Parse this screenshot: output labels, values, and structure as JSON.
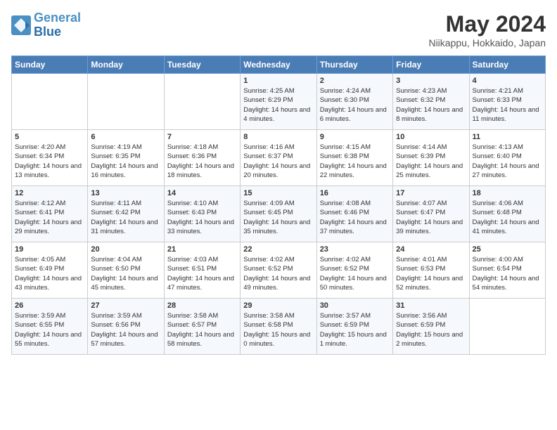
{
  "header": {
    "logo_line1": "General",
    "logo_line2": "Blue",
    "month": "May 2024",
    "location": "Niikappu, Hokkaido, Japan"
  },
  "days_of_week": [
    "Sunday",
    "Monday",
    "Tuesday",
    "Wednesday",
    "Thursday",
    "Friday",
    "Saturday"
  ],
  "weeks": [
    [
      {
        "day": "",
        "sunrise": "",
        "sunset": "",
        "daylight": ""
      },
      {
        "day": "",
        "sunrise": "",
        "sunset": "",
        "daylight": ""
      },
      {
        "day": "",
        "sunrise": "",
        "sunset": "",
        "daylight": ""
      },
      {
        "day": "1",
        "sunrise": "Sunrise: 4:25 AM",
        "sunset": "Sunset: 6:29 PM",
        "daylight": "Daylight: 14 hours and 4 minutes."
      },
      {
        "day": "2",
        "sunrise": "Sunrise: 4:24 AM",
        "sunset": "Sunset: 6:30 PM",
        "daylight": "Daylight: 14 hours and 6 minutes."
      },
      {
        "day": "3",
        "sunrise": "Sunrise: 4:23 AM",
        "sunset": "Sunset: 6:32 PM",
        "daylight": "Daylight: 14 hours and 8 minutes."
      },
      {
        "day": "4",
        "sunrise": "Sunrise: 4:21 AM",
        "sunset": "Sunset: 6:33 PM",
        "daylight": "Daylight: 14 hours and 11 minutes."
      }
    ],
    [
      {
        "day": "5",
        "sunrise": "Sunrise: 4:20 AM",
        "sunset": "Sunset: 6:34 PM",
        "daylight": "Daylight: 14 hours and 13 minutes."
      },
      {
        "day": "6",
        "sunrise": "Sunrise: 4:19 AM",
        "sunset": "Sunset: 6:35 PM",
        "daylight": "Daylight: 14 hours and 16 minutes."
      },
      {
        "day": "7",
        "sunrise": "Sunrise: 4:18 AM",
        "sunset": "Sunset: 6:36 PM",
        "daylight": "Daylight: 14 hours and 18 minutes."
      },
      {
        "day": "8",
        "sunrise": "Sunrise: 4:16 AM",
        "sunset": "Sunset: 6:37 PM",
        "daylight": "Daylight: 14 hours and 20 minutes."
      },
      {
        "day": "9",
        "sunrise": "Sunrise: 4:15 AM",
        "sunset": "Sunset: 6:38 PM",
        "daylight": "Daylight: 14 hours and 22 minutes."
      },
      {
        "day": "10",
        "sunrise": "Sunrise: 4:14 AM",
        "sunset": "Sunset: 6:39 PM",
        "daylight": "Daylight: 14 hours and 25 minutes."
      },
      {
        "day": "11",
        "sunrise": "Sunrise: 4:13 AM",
        "sunset": "Sunset: 6:40 PM",
        "daylight": "Daylight: 14 hours and 27 minutes."
      }
    ],
    [
      {
        "day": "12",
        "sunrise": "Sunrise: 4:12 AM",
        "sunset": "Sunset: 6:41 PM",
        "daylight": "Daylight: 14 hours and 29 minutes."
      },
      {
        "day": "13",
        "sunrise": "Sunrise: 4:11 AM",
        "sunset": "Sunset: 6:42 PM",
        "daylight": "Daylight: 14 hours and 31 minutes."
      },
      {
        "day": "14",
        "sunrise": "Sunrise: 4:10 AM",
        "sunset": "Sunset: 6:43 PM",
        "daylight": "Daylight: 14 hours and 33 minutes."
      },
      {
        "day": "15",
        "sunrise": "Sunrise: 4:09 AM",
        "sunset": "Sunset: 6:45 PM",
        "daylight": "Daylight: 14 hours and 35 minutes."
      },
      {
        "day": "16",
        "sunrise": "Sunrise: 4:08 AM",
        "sunset": "Sunset: 6:46 PM",
        "daylight": "Daylight: 14 hours and 37 minutes."
      },
      {
        "day": "17",
        "sunrise": "Sunrise: 4:07 AM",
        "sunset": "Sunset: 6:47 PM",
        "daylight": "Daylight: 14 hours and 39 minutes."
      },
      {
        "day": "18",
        "sunrise": "Sunrise: 4:06 AM",
        "sunset": "Sunset: 6:48 PM",
        "daylight": "Daylight: 14 hours and 41 minutes."
      }
    ],
    [
      {
        "day": "19",
        "sunrise": "Sunrise: 4:05 AM",
        "sunset": "Sunset: 6:49 PM",
        "daylight": "Daylight: 14 hours and 43 minutes."
      },
      {
        "day": "20",
        "sunrise": "Sunrise: 4:04 AM",
        "sunset": "Sunset: 6:50 PM",
        "daylight": "Daylight: 14 hours and 45 minutes."
      },
      {
        "day": "21",
        "sunrise": "Sunrise: 4:03 AM",
        "sunset": "Sunset: 6:51 PM",
        "daylight": "Daylight: 14 hours and 47 minutes."
      },
      {
        "day": "22",
        "sunrise": "Sunrise: 4:02 AM",
        "sunset": "Sunset: 6:52 PM",
        "daylight": "Daylight: 14 hours and 49 minutes."
      },
      {
        "day": "23",
        "sunrise": "Sunrise: 4:02 AM",
        "sunset": "Sunset: 6:52 PM",
        "daylight": "Daylight: 14 hours and 50 minutes."
      },
      {
        "day": "24",
        "sunrise": "Sunrise: 4:01 AM",
        "sunset": "Sunset: 6:53 PM",
        "daylight": "Daylight: 14 hours and 52 minutes."
      },
      {
        "day": "25",
        "sunrise": "Sunrise: 4:00 AM",
        "sunset": "Sunset: 6:54 PM",
        "daylight": "Daylight: 14 hours and 54 minutes."
      }
    ],
    [
      {
        "day": "26",
        "sunrise": "Sunrise: 3:59 AM",
        "sunset": "Sunset: 6:55 PM",
        "daylight": "Daylight: 14 hours and 55 minutes."
      },
      {
        "day": "27",
        "sunrise": "Sunrise: 3:59 AM",
        "sunset": "Sunset: 6:56 PM",
        "daylight": "Daylight: 14 hours and 57 minutes."
      },
      {
        "day": "28",
        "sunrise": "Sunrise: 3:58 AM",
        "sunset": "Sunset: 6:57 PM",
        "daylight": "Daylight: 14 hours and 58 minutes."
      },
      {
        "day": "29",
        "sunrise": "Sunrise: 3:58 AM",
        "sunset": "Sunset: 6:58 PM",
        "daylight": "Daylight: 15 hours and 0 minutes."
      },
      {
        "day": "30",
        "sunrise": "Sunrise: 3:57 AM",
        "sunset": "Sunset: 6:59 PM",
        "daylight": "Daylight: 15 hours and 1 minute."
      },
      {
        "day": "31",
        "sunrise": "Sunrise: 3:56 AM",
        "sunset": "Sunset: 6:59 PM",
        "daylight": "Daylight: 15 hours and 2 minutes."
      },
      {
        "day": "",
        "sunrise": "",
        "sunset": "",
        "daylight": ""
      }
    ]
  ]
}
